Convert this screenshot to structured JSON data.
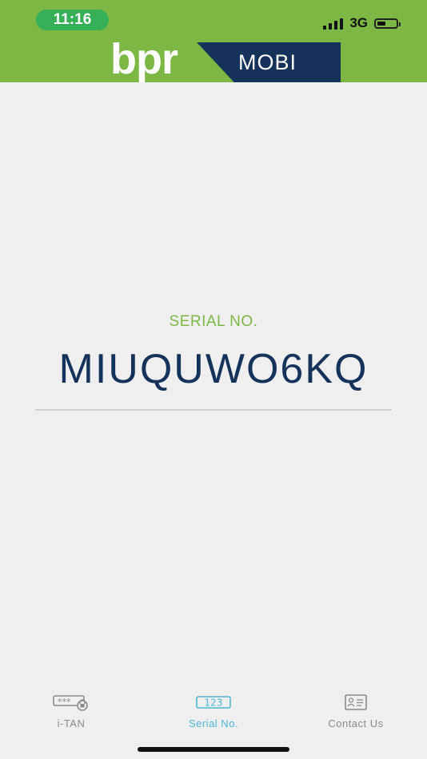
{
  "status_bar": {
    "time": "11:16",
    "network": "3G",
    "battery_level": 0.45
  },
  "header": {
    "brand": "bpr",
    "product": "MOBI"
  },
  "main": {
    "label": "SERIAL NO.",
    "serial": "MIUQUWO6KQ"
  },
  "tabs": [
    {
      "label": "i-TAN",
      "icon": "password-lock-icon",
      "active": false,
      "icon_text": "***"
    },
    {
      "label": "Serial No.",
      "icon": "number-box-icon",
      "active": true,
      "icon_text": "123"
    },
    {
      "label": "Contact Us",
      "icon": "contact-card-icon",
      "active": false
    }
  ],
  "colors": {
    "brand_green": "#7cb843",
    "navy": "#14325a",
    "active_tab": "#4cb7d6",
    "inactive_tab": "#8a8a8a"
  }
}
